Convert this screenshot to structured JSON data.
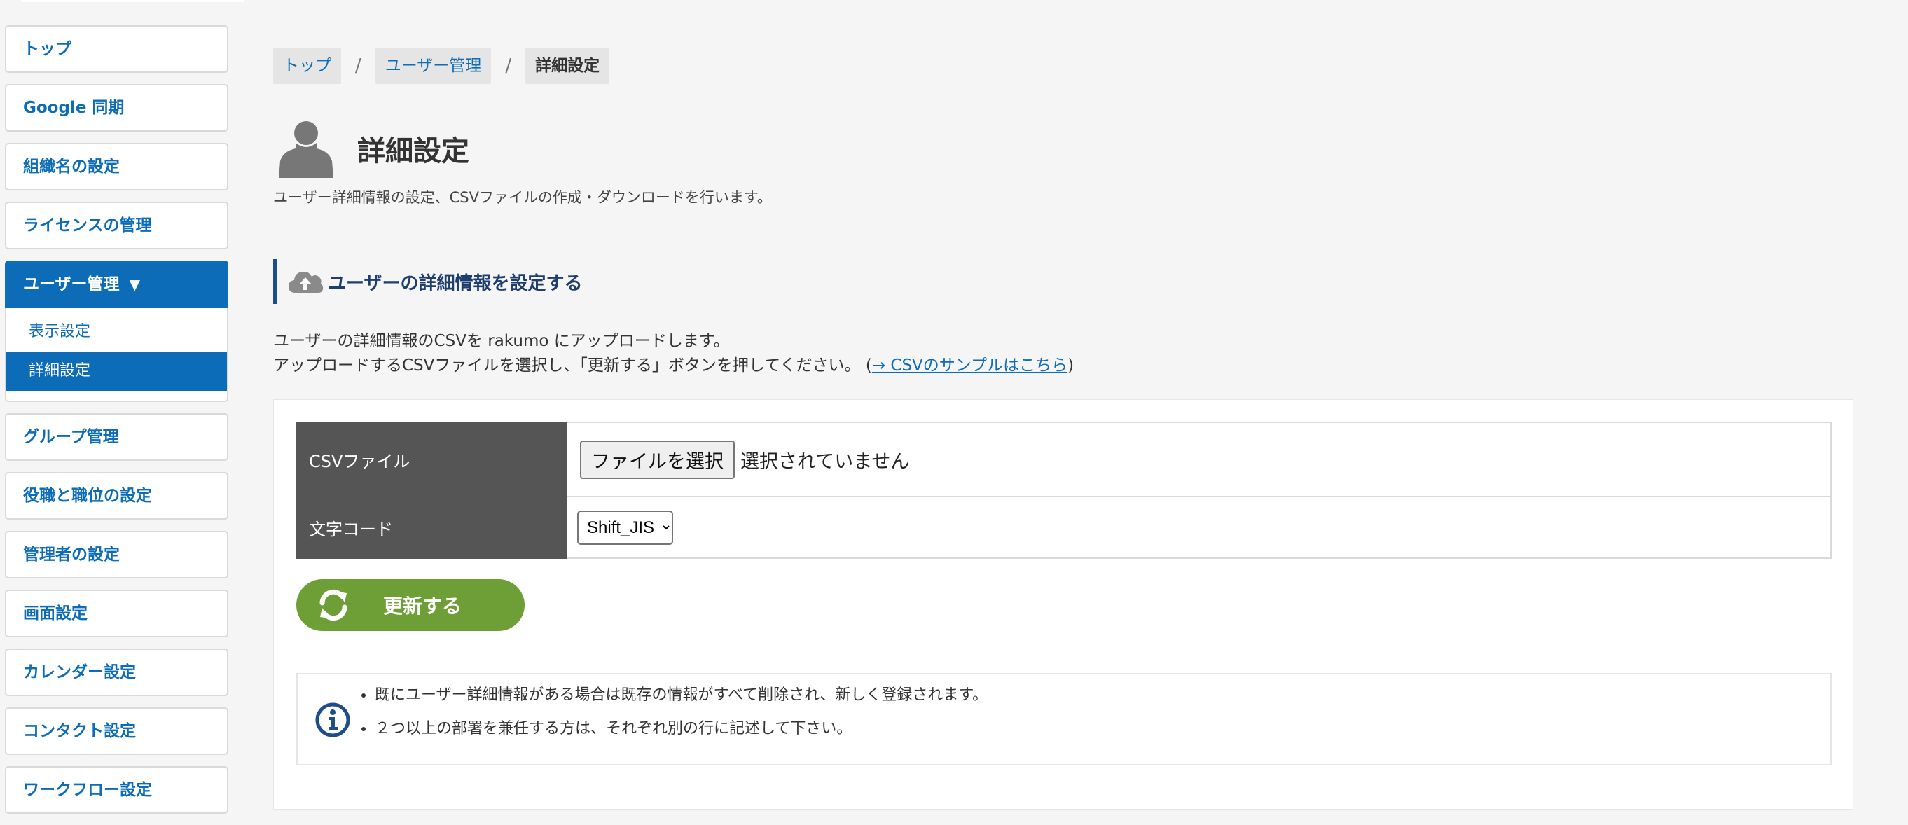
{
  "sidebar": {
    "items": [
      {
        "label": "トップ"
      },
      {
        "label": "Google 同期"
      },
      {
        "label": "組織名の設定"
      },
      {
        "label": "ライセンスの管理"
      },
      {
        "label": "ユーザー管理",
        "caret": "▼"
      },
      {
        "label": "グループ管理"
      },
      {
        "label": "役職と職位の設定"
      },
      {
        "label": "管理者の設定"
      },
      {
        "label": "画面設定"
      },
      {
        "label": "カレンダー設定"
      },
      {
        "label": "コンタクト設定"
      },
      {
        "label": "ワークフロー設定"
      }
    ],
    "subitems": [
      {
        "label": "表示設定"
      },
      {
        "label": "詳細設定"
      }
    ]
  },
  "breadcrumb": {
    "items": [
      "トップ",
      "ユーザー管理",
      "詳細設定"
    ],
    "separator": "/"
  },
  "page": {
    "title": "詳細設定",
    "description": "ユーザー詳細情報の設定、CSVファイルの作成・ダウンロードを行います。",
    "icon": "person-icon"
  },
  "section": {
    "title": "ユーザーの詳細情報を設定する",
    "icon": "cloud-upload-icon"
  },
  "intro": {
    "line1": "ユーザーの詳細情報のCSVを rakumo にアップロードします。",
    "line2": "アップロードするCSVファイルを選択し、「更新する」ボタンを押してください。 (",
    "link": "→ CSVのサンプルはこちら",
    "line2_end": ")"
  },
  "form": {
    "csv_label": "CSVファイル",
    "file_button": "ファイルを選択",
    "file_status": "選択されていません",
    "encoding_label": "文字コード",
    "encoding_value": "Shift_JIS"
  },
  "update_button": {
    "label": "更新する",
    "icon": "refresh-icon"
  },
  "info": {
    "icon": "info-icon",
    "items": [
      "既にユーザー詳細情報がある場合は既存の情報がすべて削除され、新しく登録されます。",
      "２つ以上の部署を兼任する方は、それぞれ別の行に記述して下さい。"
    ]
  },
  "colors": {
    "primary": "#0d6cb8",
    "button_green": "#6e9f37",
    "header_gray": "#555555",
    "section_navy": "#1e3f6e"
  }
}
